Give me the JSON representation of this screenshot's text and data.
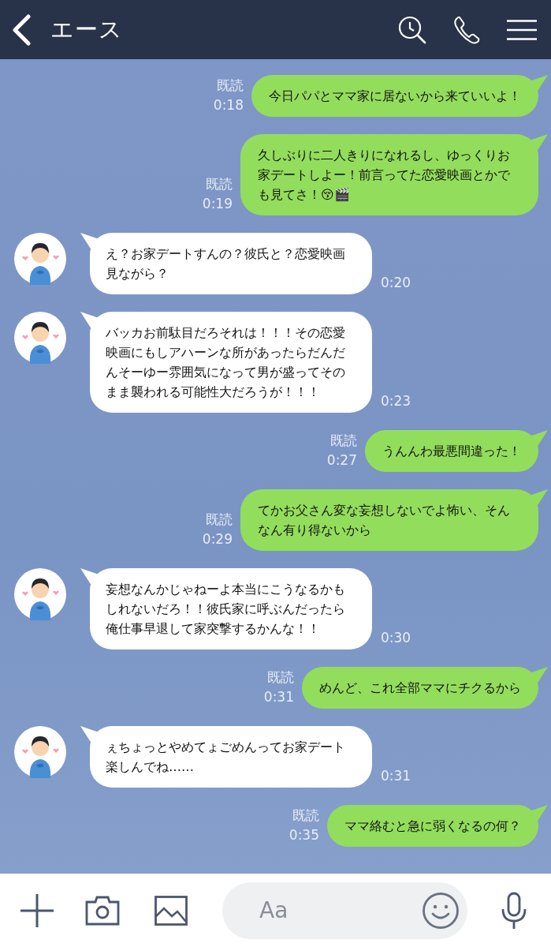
{
  "header": {
    "title": "エース"
  },
  "messages": [
    {
      "kind": "sent",
      "text": "今日パパとママ家に居ないから来ていいよ！",
      "read": "既読",
      "time": "0:18"
    },
    {
      "kind": "sent",
      "text": "久しぶりに二人きりになれるし、ゆっくりお家デートしよー！前言ってた恋愛映画とかでも見てさ！😚🎬",
      "read": "既読",
      "time": "0:19"
    },
    {
      "kind": "received",
      "text": "え？お家デートすんの？彼氏と？恋愛映画見ながら？",
      "time": "0:20"
    },
    {
      "kind": "received",
      "text": "バッカお前駄目だろそれは！！！その恋愛映画にもしアハーンな所があったらだんだんそーゆー雰囲気になって男が盛ってそのまま襲われる可能性大だろうが！！！",
      "time": "0:23"
    },
    {
      "kind": "sent",
      "text": "うんんわ最悪間違った！",
      "read": "既読",
      "time": "0:27"
    },
    {
      "kind": "sent",
      "text": "てかお父さん変な妄想しないでよ怖い、そんなん有り得ないから",
      "read": "既読",
      "time": "0:29"
    },
    {
      "kind": "received",
      "text": "妄想なんかじゃねーよ本当にこうなるかもしれないだろ！！彼氏家に呼ぶんだったら俺仕事早退して家突撃するかんな！！",
      "time": "0:30"
    },
    {
      "kind": "sent",
      "text": "めんど、これ全部ママにチクるから",
      "read": "既読",
      "time": "0:31"
    },
    {
      "kind": "received",
      "text": "ぇちょっとやめてょごめんってお家デート楽しんでね……",
      "time": "0:31"
    },
    {
      "kind": "sent",
      "text": "ママ絡むと急に弱くなるの何？",
      "read": "既読",
      "time": "0:35"
    }
  ],
  "composer": {
    "placeholder": "Aa"
  }
}
